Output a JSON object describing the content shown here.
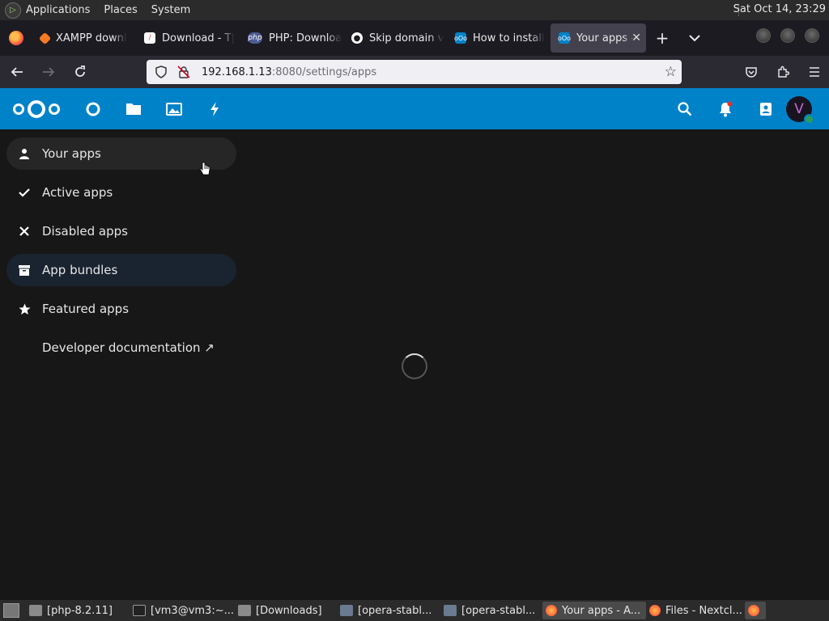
{
  "panel": {
    "menus": [
      "Applications",
      "Places",
      "System"
    ],
    "clock": "Sat Oct 14, 23:29"
  },
  "browser": {
    "tabs": [
      {
        "title": "XAMPP downl",
        "icon": "xampp-icon",
        "color": "#fb7a24"
      },
      {
        "title": "Download - T|",
        "icon": "pdf-icon",
        "color": "#e33"
      },
      {
        "title": "PHP: Downloa",
        "icon": "php-icon",
        "color": "#4f5b93"
      },
      {
        "title": "Skip domain v",
        "icon": "github-icon",
        "color": "#ffffff"
      },
      {
        "title": "How to install",
        "icon": "nextcloud-icon",
        "color": "#0082c9"
      },
      {
        "title": "Your apps - A",
        "icon": "nextcloud-icon",
        "color": "#0082c9",
        "active": true
      }
    ],
    "url_host": "192.168.1.13",
    "url_path": ":8080/settings/apps"
  },
  "nextcloud": {
    "accent": "#0082c9",
    "avatar_letter": "V",
    "apps": [
      "dashboard-icon",
      "files-icon",
      "photos-icon",
      "activity-icon"
    ]
  },
  "sidebar": {
    "items": [
      {
        "label": "Your apps",
        "icon": "user-icon"
      },
      {
        "label": "Active apps",
        "icon": "check-icon"
      },
      {
        "label": "Disabled apps",
        "icon": "close-icon"
      },
      {
        "label": "App bundles",
        "icon": "archive-icon"
      },
      {
        "label": "Featured apps",
        "icon": "star-icon"
      },
      {
        "label": "Developer documentation ↗",
        "icon": ""
      }
    ]
  },
  "taskbar": {
    "tasks": [
      {
        "label": "[php-8.2.11]",
        "icon": "folder-icon"
      },
      {
        "label": "[vm3@vm3:~...",
        "icon": "terminal-icon"
      },
      {
        "label": "[Downloads]",
        "icon": "folder-icon"
      },
      {
        "label": "[opera-stabl...",
        "icon": "package-icon"
      },
      {
        "label": "[opera-stabl...",
        "icon": "package-icon"
      },
      {
        "label": "Your apps - A...",
        "icon": "firefox-icon",
        "active": true
      },
      {
        "label": "Files - Nextcl...",
        "icon": "firefox-icon"
      }
    ]
  }
}
